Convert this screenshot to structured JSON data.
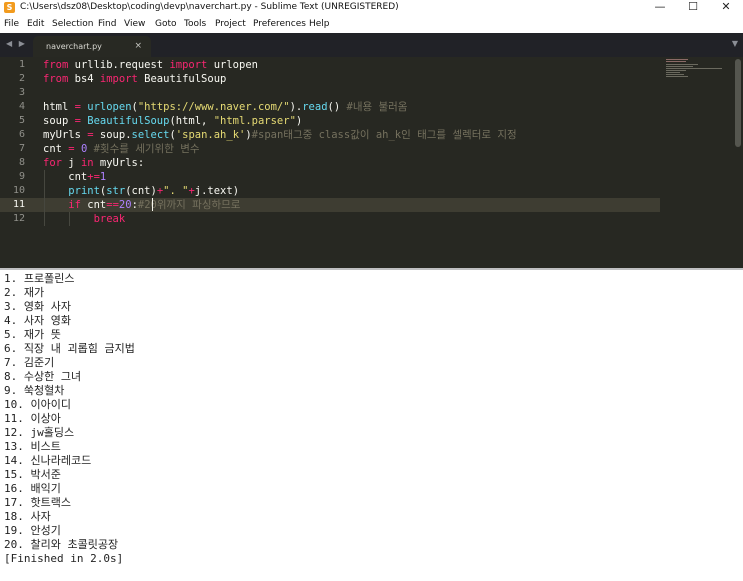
{
  "window": {
    "title": "C:\\Users\\dsz08\\Desktop\\coding\\devp\\naverchart.py - Sublime Text (UNREGISTERED)",
    "controls": {
      "minimize": "—",
      "maximize": "☐",
      "close": "✕"
    }
  },
  "menu": [
    "File",
    "Edit",
    "Selection",
    "Find",
    "View",
    "Goto",
    "Tools",
    "Project",
    "Preferences",
    "Help"
  ],
  "tabs": {
    "nav_arrows": "◀ ▶",
    "active_tab": {
      "label": "naverchart.py",
      "close": "×"
    },
    "dropdown": "▼"
  },
  "editor": {
    "line_numbers": [
      "1",
      "2",
      "3",
      "4",
      "5",
      "6",
      "7",
      "8",
      "9",
      "10",
      "11",
      "12"
    ],
    "current_line": 11,
    "lines": [
      [
        [
          "kw",
          "from"
        ],
        [
          "pl",
          " urllib.request "
        ],
        [
          "kw",
          "import"
        ],
        [
          "pl",
          " urlopen"
        ]
      ],
      [
        [
          "kw",
          "from"
        ],
        [
          "pl",
          " bs4 "
        ],
        [
          "kw",
          "import"
        ],
        [
          "pl",
          " BeautifulSoup"
        ]
      ],
      [],
      [
        [
          "pl",
          "html "
        ],
        [
          "kw",
          "="
        ],
        [
          "pl",
          " "
        ],
        [
          "fn",
          "urlopen"
        ],
        [
          "pl",
          "("
        ],
        [
          "st",
          "\"https://www.naver.com/\""
        ],
        [
          "pl",
          ")."
        ],
        [
          "fn",
          "read"
        ],
        [
          "pl",
          "() "
        ],
        [
          "cm",
          "#내용 불러옴"
        ]
      ],
      [
        [
          "pl",
          "soup "
        ],
        [
          "kw",
          "="
        ],
        [
          "pl",
          " "
        ],
        [
          "fn",
          "BeautifulSoup"
        ],
        [
          "pl",
          "(html, "
        ],
        [
          "st",
          "\"html.parser\""
        ],
        [
          "pl",
          ")"
        ]
      ],
      [
        [
          "pl",
          "myUrls "
        ],
        [
          "kw",
          "="
        ],
        [
          "pl",
          " soup."
        ],
        [
          "fn",
          "select"
        ],
        [
          "pl",
          "("
        ],
        [
          "st",
          "'span.ah_k'"
        ],
        [
          "pl",
          ")"
        ],
        [
          "cm",
          "#span태그중 class값이 ah_k인 태그를 셀렉터로 지정"
        ]
      ],
      [
        [
          "pl",
          "cnt "
        ],
        [
          "kw",
          "="
        ],
        [
          "pl",
          " "
        ],
        [
          "nu",
          "0"
        ],
        [
          "pl",
          " "
        ],
        [
          "cm",
          "#횟수를 세기위한 변수"
        ]
      ],
      [
        [
          "kw",
          "for"
        ],
        [
          "pl",
          " j "
        ],
        [
          "kw",
          "in"
        ],
        [
          "pl",
          " myUrls:"
        ]
      ],
      [
        [
          "pl",
          "    cnt"
        ],
        [
          "kw",
          "+="
        ],
        [
          "nu",
          "1"
        ]
      ],
      [
        [
          "pl",
          "    "
        ],
        [
          "fn",
          "print"
        ],
        [
          "pl",
          "("
        ],
        [
          "fn",
          "str"
        ],
        [
          "pl",
          "(cnt)"
        ],
        [
          "kw",
          "+"
        ],
        [
          "st",
          "\". \""
        ],
        [
          "kw",
          "+"
        ],
        [
          "pl",
          "j.text)"
        ]
      ],
      [
        [
          "pl",
          "    "
        ],
        [
          "kw",
          "if"
        ],
        [
          "pl",
          " cnt"
        ],
        [
          "kw",
          "=="
        ],
        [
          "nu",
          "20"
        ],
        [
          "pl",
          ":"
        ],
        [
          "cm",
          "#20위까지 파싱하므로"
        ]
      ],
      [
        [
          "pl",
          "        "
        ],
        [
          "kw",
          "break"
        ]
      ]
    ]
  },
  "console": {
    "lines": [
      "1. 프로폴린스",
      "2. 재가",
      "3. 영화 사자",
      "4. 사자 영화",
      "5. 재가 뜻",
      "6. 직장 내 괴롭힘 금지법",
      "7. 김준기",
      "8. 수상한 그녀",
      "9. 쑥청혈차",
      "10. 이아이디",
      "11. 이상아",
      "12. jw홀딩스",
      "13. 비스트",
      "14. 신나라레코드",
      "15. 박서준",
      "16. 배익기",
      "17. 핫트랙스",
      "18. 사자",
      "19. 안성기",
      "20. 찰리와 초콜릿공장",
      "[Finished in 2.0s]"
    ]
  }
}
